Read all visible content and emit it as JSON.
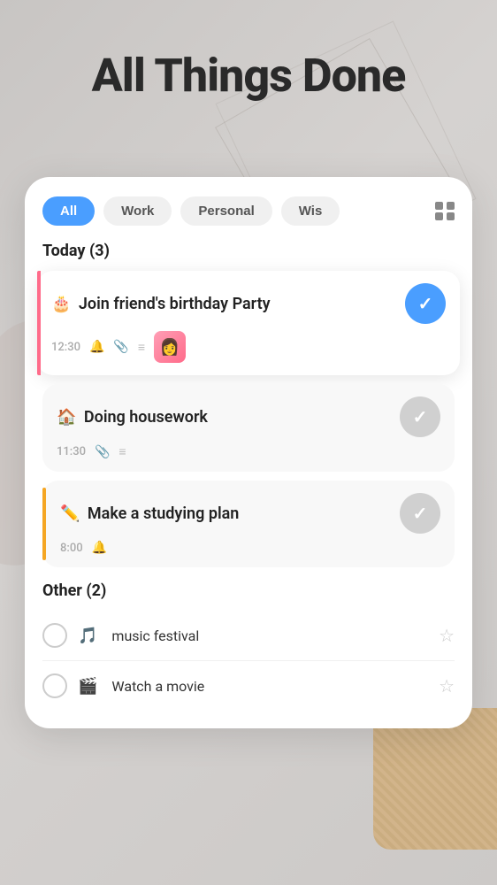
{
  "app": {
    "title": "All Things Done"
  },
  "tabs": {
    "all": {
      "label": "All",
      "active": true
    },
    "work": {
      "label": "Work",
      "active": false
    },
    "personal": {
      "label": "Personal",
      "active": false
    },
    "wishlist": {
      "label": "Wis",
      "active": false
    }
  },
  "today_section": {
    "title": "Today (3)",
    "tasks": [
      {
        "id": 1,
        "emoji": "🎂",
        "title": "Join friend's birthday Party",
        "time": "12:30",
        "has_bell": true,
        "has_clip": true,
        "has_list": true,
        "has_thumb": true,
        "completed": true,
        "highlighted": true,
        "bar_color": "pink"
      },
      {
        "id": 2,
        "emoji": "🏠",
        "title": "Doing housework",
        "time": "11:30",
        "has_bell": false,
        "has_clip": true,
        "has_list": true,
        "has_thumb": false,
        "completed": true,
        "highlighted": false,
        "bar_color": "none"
      },
      {
        "id": 3,
        "emoji": "✏️",
        "title": "Make a studying plan",
        "time": "8:00",
        "has_bell": true,
        "has_clip": false,
        "has_list": false,
        "has_thumb": false,
        "completed": false,
        "highlighted": false,
        "bar_color": "yellow"
      }
    ]
  },
  "other_section": {
    "title": "Other (2)",
    "items": [
      {
        "id": 1,
        "emoji": "🎵",
        "text": "music festival",
        "starred": false
      },
      {
        "id": 2,
        "emoji": "🎬",
        "text": "Watch a movie",
        "starred": false
      }
    ]
  },
  "colors": {
    "accent_blue": "#4a9eff",
    "yellow_bar": "#f5a623",
    "pink_bar": "#ff6b8a"
  }
}
